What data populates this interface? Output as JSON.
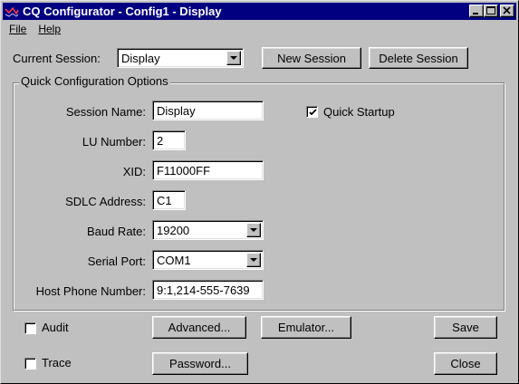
{
  "window": {
    "title": "CQ Configurator - Config1 - Display"
  },
  "menu": {
    "file": "File",
    "help": "Help"
  },
  "session": {
    "label": "Current Session:",
    "value": "Display",
    "new_button": "New Session",
    "delete_button": "Delete Session"
  },
  "quick": {
    "title": "Quick Configuration Options",
    "session_name_label": "Session Name:",
    "session_name_value": "Display",
    "lu_label": "LU Number:",
    "lu_value": "2",
    "xid_label": "XID:",
    "xid_value": "F11000FF",
    "sdlc_label": "SDLC Address:",
    "sdlc_value": "C1",
    "baud_label": "Baud Rate:",
    "baud_value": "19200",
    "port_label": "Serial Port:",
    "port_value": "COM1",
    "phone_label": "Host Phone Number:",
    "phone_value": "9:1,214-555-7639",
    "quick_startup_label": "Quick Startup",
    "quick_startup_checked": true
  },
  "bottom": {
    "audit_label": "Audit",
    "audit_checked": false,
    "trace_label": "Trace",
    "trace_checked": false,
    "advanced_button": "Advanced...",
    "emulator_button": "Emulator...",
    "password_button": "Password...",
    "save_button": "Save",
    "close_button": "Close"
  }
}
